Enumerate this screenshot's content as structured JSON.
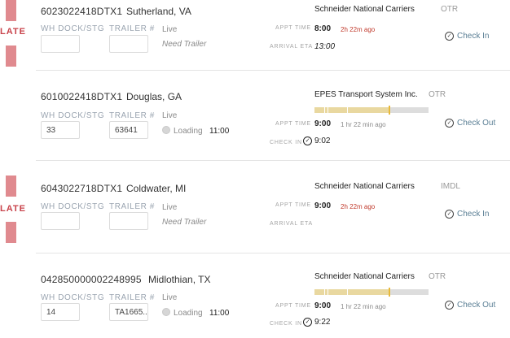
{
  "labels": {
    "wh_dock": "WH DOCK/STG",
    "trailer": "TRAILER #",
    "appt_time": "APPT TIME",
    "arrival_eta": "ARRIVAL ETA",
    "check_in": "CHECK IN",
    "late": "LATE"
  },
  "loads": [
    {
      "id": "6023022418DTX1",
      "location": "Sutherland, VA",
      "wh_dock": "",
      "trailer": "",
      "live": "Live",
      "need_trailer": "Need Trailer",
      "carrier": "Schneider National Carriers",
      "mode": "OTR",
      "appt_time": "8:00",
      "appt_ago": "2h 22m ago",
      "arrival_eta": "13:00",
      "action": "Check In",
      "late": true
    },
    {
      "id": "6010022418DTX1",
      "location": "Douglas, GA",
      "wh_dock": "33",
      "trailer": "63641",
      "live": "Live",
      "loading_label": "Loading",
      "loading_time": "11:00",
      "carrier": "EPES Transport System Inc.",
      "mode": "OTR",
      "appt_time": "9:00",
      "appt_ago": "1 hr 22 min ago",
      "checkin_time": "9:02",
      "action": "Check Out",
      "progress": 0.66,
      "late": false
    },
    {
      "id": "6043022718DTX1",
      "location": "Coldwater, MI",
      "wh_dock": "",
      "trailer": "",
      "live": "Live",
      "need_trailer": "Need Trailer",
      "carrier": "Schneider National Carriers",
      "mode": "IMDL",
      "appt_time": "9:00",
      "appt_ago": "2h 22m ago",
      "action": "Check In",
      "late": true
    },
    {
      "id": "042850000002248995",
      "location": "Midlothian, TX",
      "wh_dock": "14",
      "trailer": "TA1665...",
      "live": "Live",
      "loading_label": "Loading",
      "loading_time": "11:00",
      "carrier": "Schneider National Carriers",
      "mode": "OTR",
      "appt_time": "9:00",
      "appt_ago": "1 hr 22 min ago",
      "checkin_time": "9:22",
      "action": "Check Out",
      "progress": 0.66,
      "late": false
    }
  ],
  "colors": {
    "late": "#c8424a",
    "late_bar": "#e08a8f",
    "ago_late": "#c0392b",
    "ago_ok": "#8a8a8a",
    "action": "#5b7f95",
    "progress_fill": "#e9d8a0",
    "progress_marker": "#e8b93a"
  },
  "icons": {
    "check": "check-circle-icon",
    "loading": "loading-dot-icon"
  }
}
